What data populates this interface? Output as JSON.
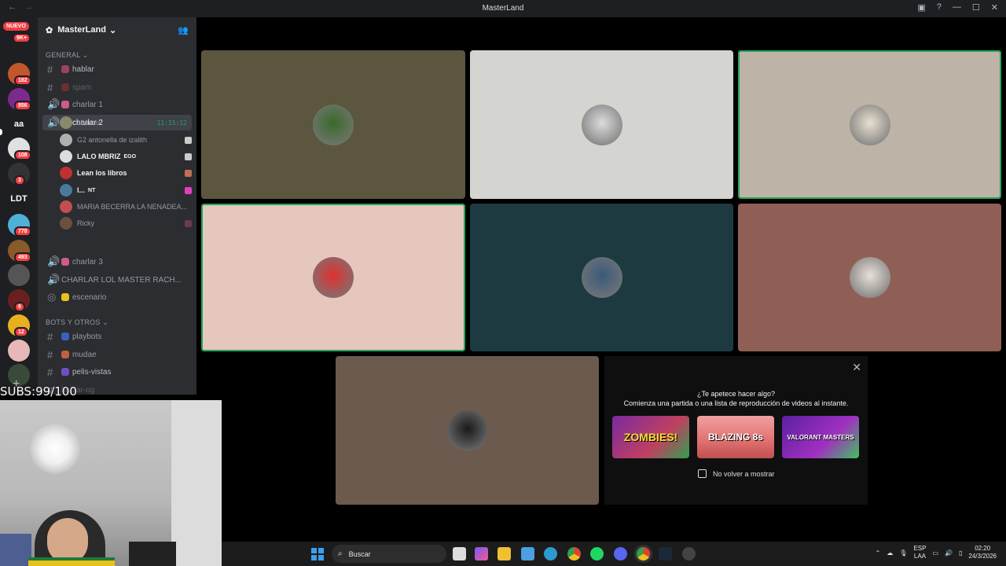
{
  "window": {
    "title": "MasterLand"
  },
  "rail": {
    "new_badge": "NUEVO",
    "dm_count": "9K+",
    "servers": [
      {
        "label": "",
        "badge": "182",
        "color": "#c2572b"
      },
      {
        "label": "",
        "badge": "856",
        "color": "#7b2a8e"
      },
      {
        "label": "aa",
        "badge": "",
        "color": "#1e1f22"
      },
      {
        "label": "",
        "badge": "108",
        "color": "#e0e0e0"
      },
      {
        "label": "",
        "badge": "3",
        "color": "#333"
      },
      {
        "label": "LDT",
        "badge": "",
        "color": "#1e1f22"
      },
      {
        "label": "",
        "badge": "778",
        "color": "#4fb0d8"
      },
      {
        "label": "",
        "badge": "493",
        "color": "#8a5a2b"
      },
      {
        "label": "",
        "badge": "",
        "color": "#555"
      },
      {
        "label": "",
        "badge": "6",
        "color": "#6b2020"
      },
      {
        "label": "",
        "badge": "12",
        "color": "#e8b020"
      },
      {
        "label": "",
        "badge": "",
        "color": "#e8b8b8"
      },
      {
        "label": "",
        "badge": "",
        "color": "#3a4a3a"
      }
    ]
  },
  "guild": {
    "name": "MasterLand"
  },
  "categories": {
    "general": "GENERAL",
    "bots": "BOTS Y OTROS"
  },
  "channels": {
    "hablar": "hablar",
    "spam": "spam",
    "charlar1": "charlar 1",
    "charlar2": "charlar 2",
    "charlar2_time": "11:15:12",
    "charlar3": "charlar 3",
    "charlar_lol": "CHARLAR LOL MASTER RACH...",
    "escenario": "escenario",
    "playbots": "playbots",
    "mudae": "mudae",
    "pelis": "pelis-vistas",
    "hablar_og": "hablar-og"
  },
  "voice_users": [
    {
      "name": "chancu",
      "bold": false
    },
    {
      "name": "G2 antonella de izalith",
      "bold": false
    },
    {
      "name": "LALO MBRIZ",
      "bold": true,
      "tag": "EGO"
    },
    {
      "name": "Lean los libros",
      "bold": true
    },
    {
      "name": "l...",
      "bold": true,
      "tag": "NT"
    },
    {
      "name": "MARIA BECERRA LA NENADEA...",
      "bold": false
    },
    {
      "name": "Ricky",
      "bold": false
    }
  ],
  "overlay": {
    "subs": "SUBS:99/100"
  },
  "activity": {
    "question": "¿Te apetece hacer algo?",
    "subtitle": "Comienza una partida o una lista de reproducción de videos al instante.",
    "games": [
      "ZOMBIES!",
      "BLAZING 8s",
      "VALORANT MASTERS"
    ],
    "dont_show": "No volver a mostrar"
  },
  "taskbar": {
    "search_placeholder": "Buscar",
    "lang": "ESP",
    "lang2": "LAA",
    "time": "02:20",
    "date": "24/3/2026"
  },
  "tile_colors": [
    "#5c563f",
    "#d4d5d0",
    "#bdb4a7",
    "#e5c7bd",
    "#1c3a40",
    "#8f5f56",
    "#6b5a4d"
  ]
}
